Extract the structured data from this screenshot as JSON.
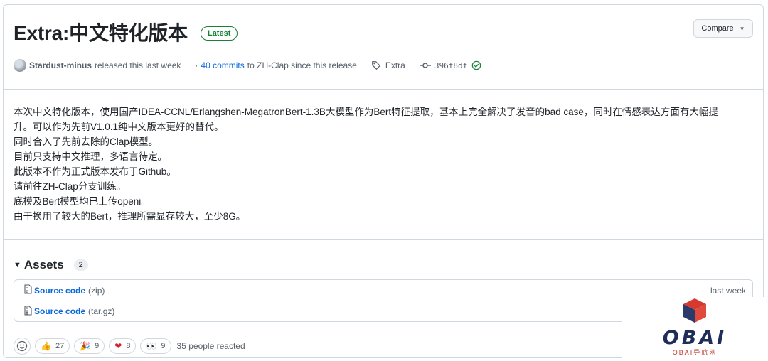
{
  "release": {
    "title": "Extra:中文特化版本",
    "badge": "Latest",
    "compare_label": "Compare"
  },
  "meta": {
    "author": "Stardust-minus",
    "released_text": "released this last week",
    "commits_prefix": "·",
    "commits_link": "40 commits",
    "commits_suffix": "to ZH-Clap since this release",
    "tag": "Extra",
    "commit_hash": "396f8df"
  },
  "body": {
    "lines": [
      "本次中文特化版本，使用国产IDEA-CCNL/Erlangshen-MegatronBert-1.3B大模型作为Bert特征提取，基本上完全解决了发音的bad case，同时在情感表达方面有大幅提",
      "升。可以作为先前V1.0.1纯中文版本更好的替代。",
      "同时合入了先前去除的Clap模型。",
      "目前只支持中文推理，多语言待定。",
      "此版本不作为正式版本发布于Github。",
      "请前往ZH-Clap分支训练。",
      "底模及Bert模型均已上传openi。",
      "由于换用了较大的Bert，推理所需显存较大，至少8G。"
    ]
  },
  "assets": {
    "title": "Assets",
    "count": "2",
    "items": [
      {
        "name": "Source code",
        "ext": "(zip)",
        "date": "last week"
      },
      {
        "name": "Source code",
        "ext": "(tar.gz)",
        "date": ""
      }
    ]
  },
  "reactions": {
    "items": [
      {
        "symbol": "👍",
        "count": "27"
      },
      {
        "symbol": "🎉",
        "count": "9"
      },
      {
        "symbol": "❤",
        "count": "8"
      },
      {
        "symbol": "👀",
        "count": "9"
      }
    ],
    "summary": "35 people reacted"
  },
  "watermark": {
    "text": "OBAI",
    "sub": "OBAI导航网"
  },
  "colors": {
    "link": "#0969da",
    "latest": "#1a7f37",
    "border": "#d0d7de"
  }
}
